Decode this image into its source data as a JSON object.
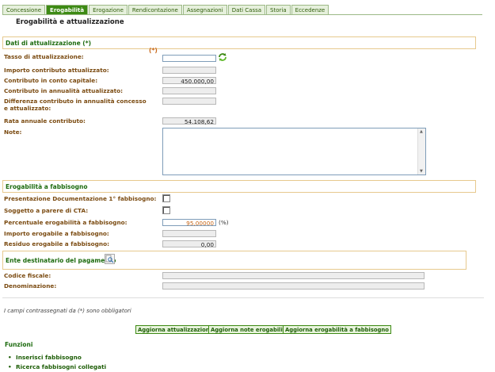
{
  "tabs": [
    {
      "label": "Concessione",
      "active": false
    },
    {
      "label": "Erogabilità",
      "active": true
    },
    {
      "label": "Erogazione",
      "active": false
    },
    {
      "label": "Rendicontazione",
      "active": false
    },
    {
      "label": "Assegnazioni",
      "active": false
    },
    {
      "label": "Dati Cassa",
      "active": false
    },
    {
      "label": "Storia",
      "active": false
    },
    {
      "label": "Eccedenze",
      "active": false
    }
  ],
  "page_title": "Erogabilità e attualizzazione",
  "attualizzazione": {
    "section_title": "Dati di attualizzazione (*)",
    "required_mark": "(*)",
    "tasso_label": "Tasso di attualizzazione:",
    "tasso_value": "",
    "importo_label": "Importo contributo attualizzato:",
    "importo_value": "",
    "capitale_label": "Contributo in conto capitale:",
    "capitale_value": "450.000,00",
    "annualita_label": "Contributo in annualità attualizzato:",
    "annualita_value": "",
    "differenza_label": "Differenza contributo in annualità concesso e attualizzato:",
    "differenza_value": "",
    "rata_label": "Rata annuale contributo:",
    "rata_value": "54.108,62",
    "note_label": "Note:",
    "note_value": ""
  },
  "fabbisogno": {
    "section_title": "Erogabilità a fabbisogno",
    "presentazione_label": "Presentazione Documentazione 1° fabbisogno:",
    "cta_label": "Soggetto a parere di CTA:",
    "percentuale_label": "Percentuale erogabilità a fabbisogno:",
    "percentuale_value": "95,00000",
    "percentuale_unit": "(%)",
    "importo_label": "Importo erogabile a fabbisogno:",
    "importo_value": "",
    "residuo_label": "Residuo erogabile a fabbisogno:",
    "residuo_value": "0,00"
  },
  "ente": {
    "section_title": "Ente destinatario del pagamento",
    "codice_label": "Codice fiscale:",
    "codice_value": "",
    "denominazione_label": "Denominazione:",
    "denominazione_value": ""
  },
  "required_note": "I campi contrassegnati da (*) sono obbligatori",
  "buttons": {
    "aggiorna_attualizzazione": "Aggiorna attualizzazione",
    "aggiorna_note": "Aggiorna note erogabilità",
    "aggiorna_fabbisogno": "Aggiorna erogabilità a fabbisogno"
  },
  "funzioni": {
    "title": "Funzioni",
    "items": [
      "Inserisci fabbisogno",
      "Ricerca fabbisogni collegati"
    ]
  },
  "colors": {
    "accent": "#3d8a14",
    "label": "#7a4a10",
    "section_border": "#e7c98e"
  },
  "icons": {
    "refresh": "refresh-icon",
    "search": "search-document-icon"
  }
}
